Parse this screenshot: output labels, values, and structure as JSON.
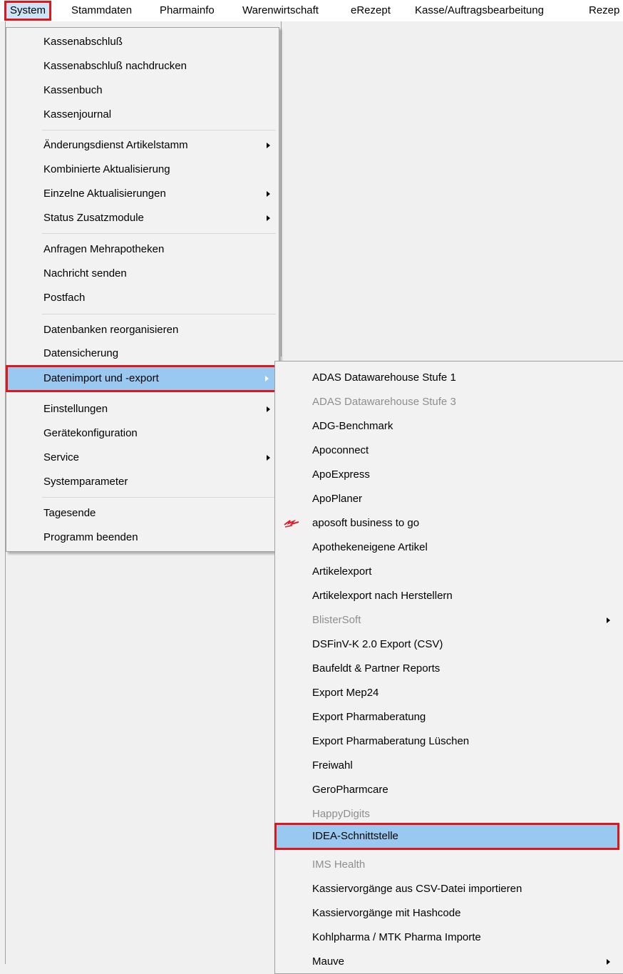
{
  "menubar": {
    "items": [
      "System",
      "Stammdaten",
      "Pharmainfo",
      "Warenwirtschaft",
      "eRezept",
      "Kasse/Auftragsbearbeitung",
      "Rezep"
    ]
  },
  "system_menu": {
    "items": [
      {
        "label": "Kassenabschluß",
        "submenu": false
      },
      {
        "label": "Kassenabschluß nachdrucken",
        "submenu": false
      },
      {
        "label": "Kassenbuch",
        "submenu": false
      },
      {
        "label": "Kassenjournal",
        "submenu": false
      },
      {
        "label": "Änderungsdienst Artikelstamm",
        "submenu": true
      },
      {
        "label": "Kombinierte Aktualisierung",
        "submenu": false
      },
      {
        "label": "Einzelne Aktualisierungen",
        "submenu": true
      },
      {
        "label": "Status Zusatzmodule",
        "submenu": true
      },
      {
        "label": "Anfragen Mehrapotheken",
        "submenu": false
      },
      {
        "label": "Nachricht senden",
        "submenu": false
      },
      {
        "label": "Postfach",
        "submenu": false
      },
      {
        "label": "Datenbanken reorganisieren",
        "submenu": false
      },
      {
        "label": "Datensicherung",
        "submenu": false
      },
      {
        "label": "Datenimport und -export",
        "submenu": true,
        "active": true
      },
      {
        "label": "Einstellungen",
        "submenu": true
      },
      {
        "label": "Gerätekonfiguration",
        "submenu": false
      },
      {
        "label": "Service",
        "submenu": true
      },
      {
        "label": "Systemparameter",
        "submenu": false
      },
      {
        "label": "Tagesende",
        "submenu": false
      },
      {
        "label": "Programm beenden",
        "submenu": false
      }
    ]
  },
  "import_export_submenu": {
    "items": [
      {
        "label": "ADAS Datawarehouse Stufe 1",
        "disabled": false
      },
      {
        "label": "ADAS Datawarehouse Stufe 3",
        "disabled": true
      },
      {
        "label": "ADG-Benchmark",
        "disabled": false
      },
      {
        "label": "Apoconnect",
        "disabled": false
      },
      {
        "label": "ApoExpress",
        "disabled": false
      },
      {
        "label": "ApoPlaner",
        "disabled": false
      },
      {
        "label": "aposoft business to go",
        "disabled": false,
        "icon": "aposoft-logo-icon"
      },
      {
        "label": "Apothekeneigene Artikel",
        "disabled": false
      },
      {
        "label": "Artikelexport",
        "disabled": false
      },
      {
        "label": "Artikelexport nach Herstellern",
        "disabled": false
      },
      {
        "label": "BlisterSoft",
        "disabled": true,
        "submenu": true
      },
      {
        "label": "DSFinV-K 2.0 Export (CSV)",
        "disabled": false
      },
      {
        "label": "Baufeldt & Partner Reports",
        "disabled": false
      },
      {
        "label": "Export Mep24",
        "disabled": false
      },
      {
        "label": "Export Pharmaberatung",
        "disabled": false
      },
      {
        "label": "Export Pharmaberatung Lüschen",
        "disabled": false
      },
      {
        "label": "Freiwahl",
        "disabled": false
      },
      {
        "label": "GeroPharmcare",
        "disabled": false
      },
      {
        "label": "HappyDigits",
        "disabled": true
      },
      {
        "label": "IDEA-Schnittstelle",
        "disabled": false,
        "active": true
      },
      {
        "label": "IMS Health",
        "disabled": true
      },
      {
        "label": "Kassiervorgänge aus CSV-Datei importieren",
        "disabled": false
      },
      {
        "label": "Kassiervorgänge mit Hashcode",
        "disabled": false
      },
      {
        "label": "Kohlpharma / MTK Pharma Importe",
        "disabled": false
      },
      {
        "label": "Mauve",
        "disabled": false,
        "submenu": true
      }
    ]
  },
  "colors": {
    "highlight": "#99c9f1",
    "callout_box": "#e0161b",
    "menu_bg": "#f2f2f2",
    "disabled_text": "#8e8e8e"
  }
}
